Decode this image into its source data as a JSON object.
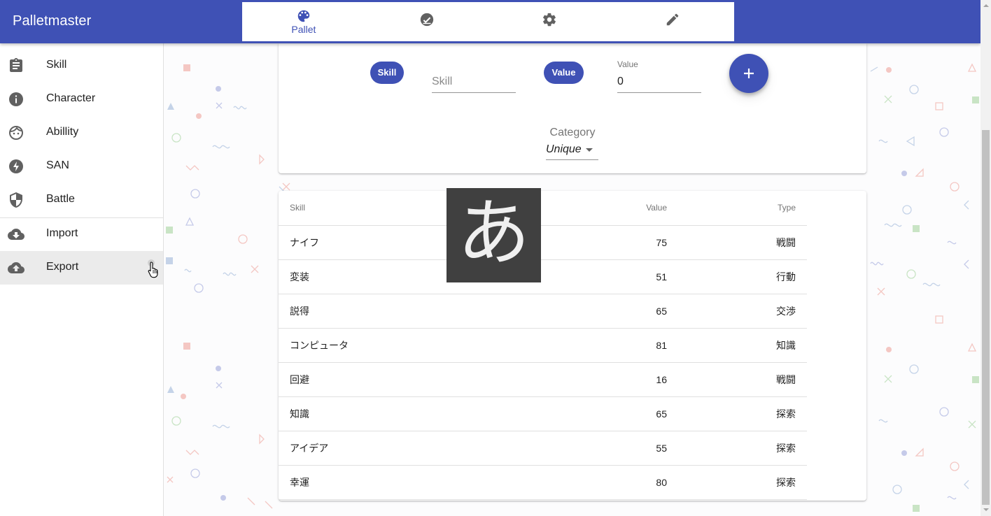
{
  "app": {
    "title": "Palletmaster"
  },
  "tabs": [
    {
      "label": "Pallet",
      "icon": "palette-icon"
    },
    {
      "label": "",
      "icon": "check-circle-icon"
    },
    {
      "label": "",
      "icon": "gear-icon"
    },
    {
      "label": "",
      "icon": "pencil-icon"
    }
  ],
  "sidebar": {
    "items": [
      {
        "label": "Skill",
        "icon": "clipboard-icon"
      },
      {
        "label": "Character",
        "icon": "info-icon"
      },
      {
        "label": "Abillity",
        "icon": "face-icon"
      },
      {
        "label": "SAN",
        "icon": "bolt-icon"
      },
      {
        "label": "Battle",
        "icon": "shield-icon"
      },
      {
        "label": "Import",
        "icon": "cloud-download-icon"
      },
      {
        "label": "Export",
        "icon": "cloud-upload-icon"
      }
    ]
  },
  "form": {
    "skill_chip": "Skill",
    "skill_placeholder": "Skill",
    "value_chip": "Value",
    "value_label": "Value",
    "value_input": "0",
    "category_label": "Category",
    "category_value": "Unique"
  },
  "table": {
    "headers": [
      "Skill",
      "Value",
      "Type"
    ],
    "rows": [
      [
        "ナイフ",
        "75",
        "戦闘"
      ],
      [
        "変装",
        "51",
        "行動"
      ],
      [
        "説得",
        "65",
        "交渉"
      ],
      [
        "コンピュータ",
        "81",
        "知識"
      ],
      [
        "回避",
        "16",
        "戦闘"
      ],
      [
        "知識",
        "65",
        "探索"
      ],
      [
        "アイデア",
        "55",
        "探索"
      ],
      [
        "幸運",
        "80",
        "探索"
      ]
    ]
  },
  "ime_indicator": "あ",
  "colors": {
    "primary": "#3f51b5",
    "drawer_active": "#ebebeb"
  }
}
